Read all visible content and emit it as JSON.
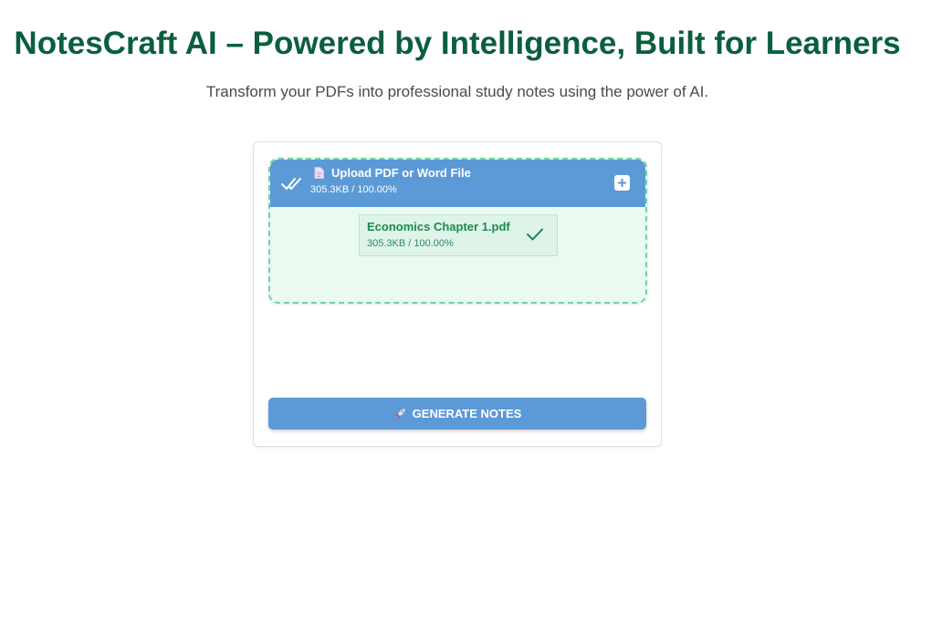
{
  "header": {
    "title": "NotesCraft AI – Powered by Intelligence, Built for Learners",
    "subtitle": "Transform your PDFs into professional study notes using the power of AI."
  },
  "upload": {
    "title": "Upload PDF or Word File",
    "progress_text": "305.3KB / 100.00%",
    "add_icon": "plus-icon",
    "status_icon": "double-check-icon",
    "file_icon": "document-icon",
    "files": [
      {
        "name": "Economics Chapter 1.pdf",
        "size_text": "305.3KB / 100.00%",
        "status_icon": "check-icon"
      }
    ]
  },
  "actions": {
    "generate_label": "GENERATE NOTES",
    "generate_icon": "rocket-icon"
  },
  "colors": {
    "title": "#0b5e3e",
    "accent_blue": "#5b9ad6",
    "dropzone_bg": "#eafaf1",
    "dropzone_border": "#6fd4a0",
    "file_text": "#1a8a52"
  }
}
